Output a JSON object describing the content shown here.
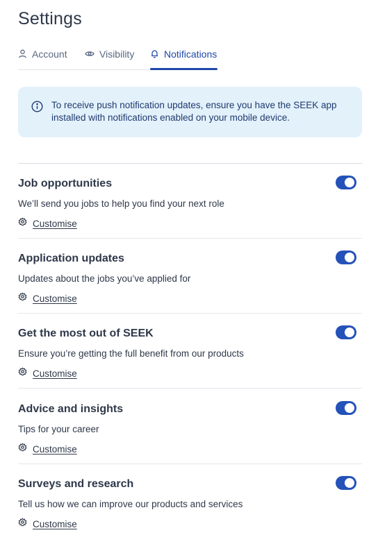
{
  "page": {
    "title": "Settings"
  },
  "tabs": [
    {
      "label": "Account",
      "icon": "person-icon",
      "active": false
    },
    {
      "label": "Visibility",
      "icon": "eye-icon",
      "active": false
    },
    {
      "label": "Notifications",
      "icon": "bell-icon",
      "active": true
    }
  ],
  "info": {
    "icon": "info-icon",
    "text": "To receive push notification updates, ensure you have the SEEK app installed with notifications enabled on your mobile device."
  },
  "sections": [
    {
      "title": "Job opportunities",
      "description": "We’ll send you jobs to help you find your next role",
      "customise_label": "Customise",
      "enabled": true
    },
    {
      "title": "Application updates",
      "description": "Updates about the jobs you’ve applied for",
      "customise_label": "Customise",
      "enabled": true
    },
    {
      "title": "Get the most out of SEEK",
      "description": "Ensure you’re getting the full benefit from our products",
      "customise_label": "Customise",
      "enabled": true
    },
    {
      "title": "Advice and insights",
      "description": "Tips for your career",
      "customise_label": "Customise",
      "enabled": true
    },
    {
      "title": "Surveys and research",
      "description": "Tell us how we can improve our products and services",
      "customise_label": "Customise",
      "enabled": true
    }
  ],
  "colors": {
    "accent": "#2452b8",
    "active_tab": "#1e47a8",
    "info_bg": "#e3f1fb",
    "text": "#2e3849"
  }
}
